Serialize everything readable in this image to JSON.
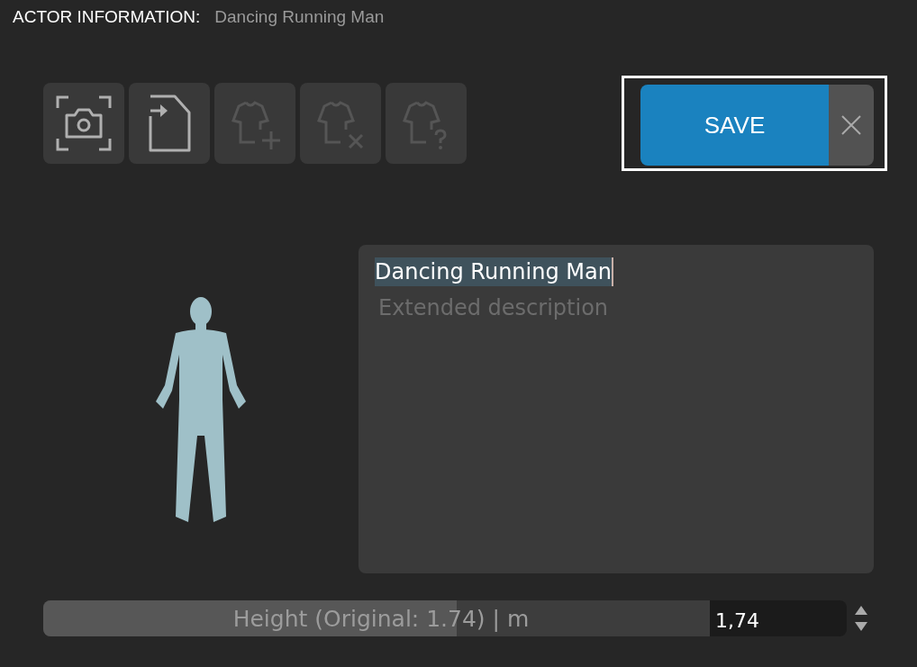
{
  "header": {
    "label": "ACTOR INFORMATION:",
    "name": "Dancing Running Man"
  },
  "toolbar": [
    {
      "kind": "camera",
      "disabled": false
    },
    {
      "kind": "import",
      "disabled": false
    },
    {
      "kind": "shirt-add",
      "disabled": true
    },
    {
      "kind": "shirt-remove",
      "disabled": true
    },
    {
      "kind": "shirt-help",
      "disabled": true
    }
  ],
  "save_button": {
    "label": "SAVE",
    "highlighted": true
  },
  "description": {
    "title": "Dancing Running Man",
    "placeholder": "Extended description"
  },
  "height": {
    "label": "Height (Original: 1.74) | m",
    "level": 0.62,
    "value": "1,74"
  }
}
